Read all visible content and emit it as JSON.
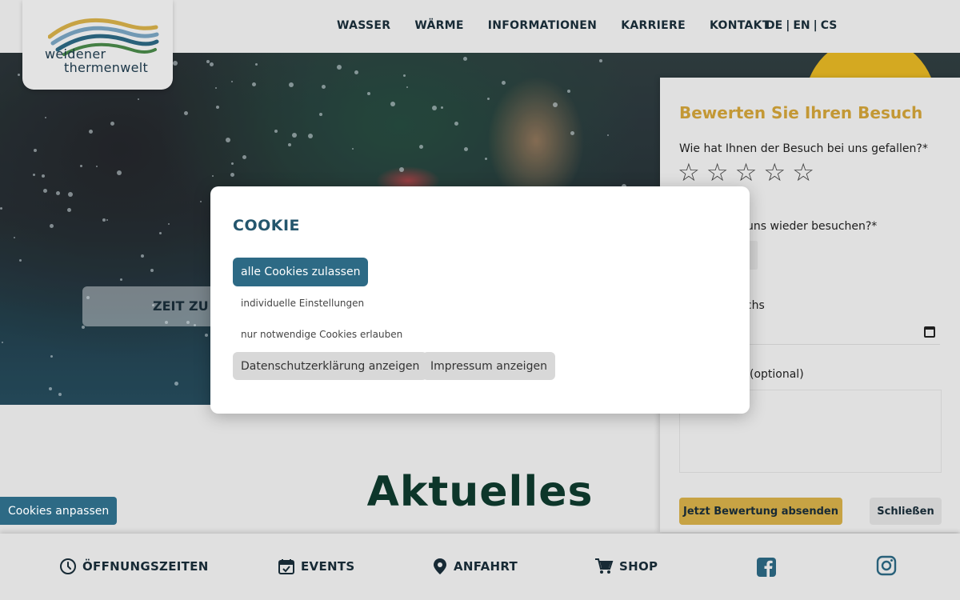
{
  "header": {
    "logo_line1": "weidener",
    "logo_line2": "thermenwelt",
    "nav": [
      "WASSER",
      "WÄRME",
      "INFORMATIONEN",
      "KARRIERE",
      "KONTAKT"
    ],
    "languages": [
      "DE",
      "EN",
      "CS"
    ],
    "lang_separator": "|"
  },
  "hero": {
    "banner_text": "ZEIT ZU"
  },
  "rating": {
    "title": "Bewerten Sie Ihren Besuch",
    "question1": "Wie hat Ihnen der Besuch bei uns gefallen?*",
    "stars": 5,
    "question2_partial": "uns wieder besuchen?*",
    "question3_partial": "uchs",
    "question4_partial": "(optional)",
    "submit_label": "Jetzt Bewertung absenden",
    "close_label": "Schließen",
    "title_color": "#d4a53a",
    "submit_color": "#d8b14a"
  },
  "main": {
    "heading": "Aktuelles"
  },
  "cookie_modal": {
    "title": "COOKIE",
    "allow_all_label": "alle Cookies zulassen",
    "individual_label": "individuelle Einstellungen",
    "necessary_only_label": "nur notwendige Cookies erlauben",
    "privacy_label": "Datenschutzerklärung anzeigen",
    "imprint_label": "Impressum anzeigen",
    "accent_color": "#2d6a85"
  },
  "cookies_adjust_label": "Cookies anpassen",
  "bottombar": {
    "items": [
      {
        "label": "ÖFFNUNGSZEITEN",
        "icon": "clock-icon"
      },
      {
        "label": "EVENTS",
        "icon": "calendar-icon"
      },
      {
        "label": "ANFAHRT",
        "icon": "map-pin-icon"
      },
      {
        "label": "SHOP",
        "icon": "cart-icon"
      }
    ],
    "social": [
      "facebook-icon",
      "instagram-icon"
    ]
  }
}
